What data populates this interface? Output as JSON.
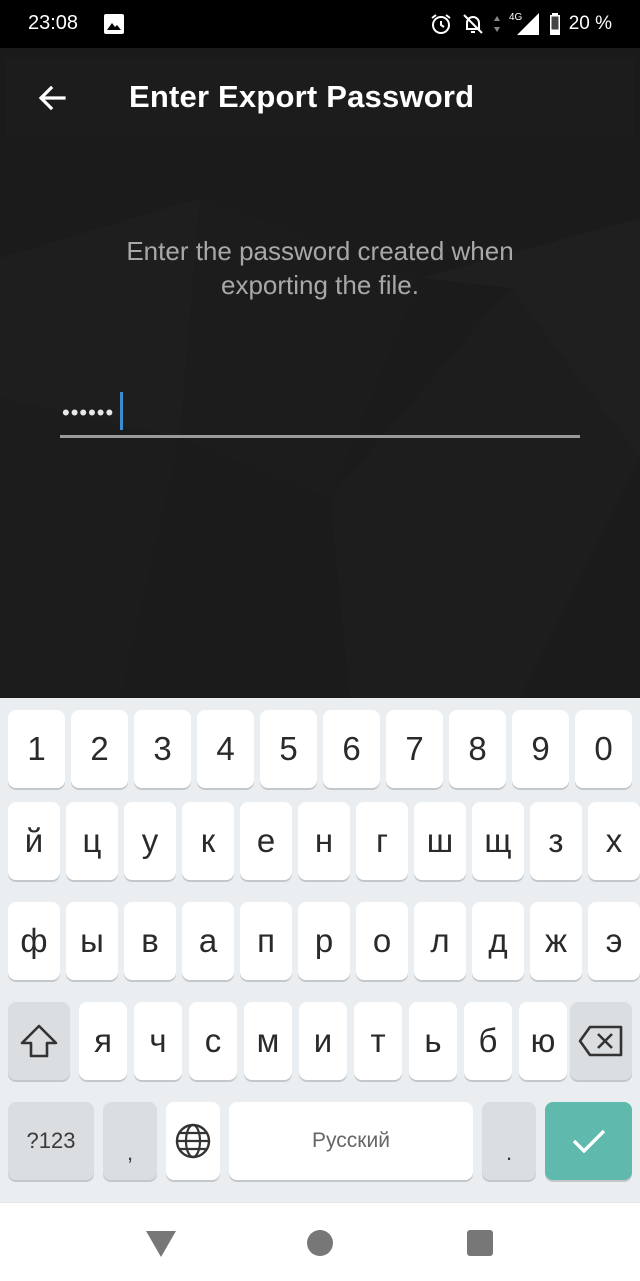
{
  "status_bar": {
    "time": "23:08",
    "network": "4G",
    "battery": "20 %",
    "icons": [
      "image-icon",
      "alarm-icon",
      "notifications-off-icon",
      "data-arrows-icon",
      "signal-icon",
      "battery-icon"
    ]
  },
  "app_bar": {
    "title": "Enter Export Password",
    "back_icon": "arrow-back-icon"
  },
  "main": {
    "instruction": "Enter the password created when exporting the file.",
    "password_value": "••••••"
  },
  "keyboard": {
    "rows": [
      [
        "1",
        "2",
        "3",
        "4",
        "5",
        "6",
        "7",
        "8",
        "9",
        "0"
      ],
      [
        "й",
        "ц",
        "у",
        "к",
        "е",
        "н",
        "г",
        "ш",
        "щ",
        "з",
        "х"
      ],
      [
        "ф",
        "ы",
        "в",
        "а",
        "п",
        "р",
        "о",
        "л",
        "д",
        "ж",
        "э"
      ],
      [
        "я",
        "ч",
        "с",
        "м",
        "и",
        "т",
        "ь",
        "б",
        "ю"
      ]
    ],
    "symbols_label": "?123",
    "comma": ",",
    "space_label": "Русский",
    "period": ".",
    "icons": [
      "shift-icon",
      "backspace-icon",
      "globe-icon",
      "check-icon"
    ],
    "accent_color": "#5fb9ac"
  },
  "nav_bar": {
    "icons": [
      "nav-back-icon",
      "nav-home-icon",
      "nav-recents-icon"
    ]
  }
}
